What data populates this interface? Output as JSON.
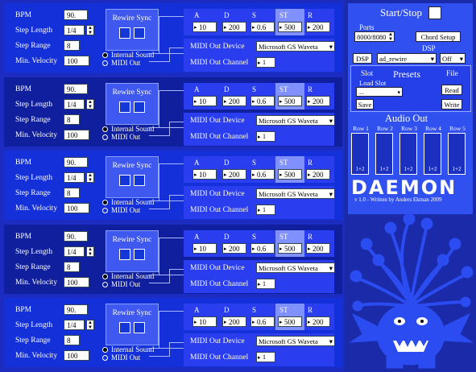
{
  "rows": [
    {
      "bpm": "90.",
      "step_length": "1/4",
      "step_range": "8",
      "min_velocity": "100",
      "rewire_title": "Rewire Sync",
      "radio_internal": "Internal Sound",
      "radio_midi": "MIDI Out",
      "selected": "internal",
      "env": {
        "A": "10",
        "D": "200",
        "S": "0.6",
        "ST": "500",
        "R": "200"
      },
      "midi_device_label": "MIDI Out Device",
      "midi_device": "Microsoft GS Waveta",
      "midi_channel_label": "MIDI Out Channel",
      "midi_channel": "1"
    },
    {
      "bpm": "90.",
      "step_length": "1/4",
      "step_range": "8",
      "min_velocity": "100",
      "rewire_title": "Rewire Sync",
      "radio_internal": "Internal Sound",
      "radio_midi": "MIDI Out",
      "selected": "internal",
      "env": {
        "A": "10",
        "D": "200",
        "S": "0.6",
        "ST": "500",
        "R": "200"
      },
      "midi_device_label": "MIDI Out Device",
      "midi_device": "Microsoft GS Waveta",
      "midi_channel_label": "MIDI Out Channel",
      "midi_channel": "1"
    },
    {
      "bpm": "90.",
      "step_length": "1/4",
      "step_range": "8",
      "min_velocity": "100",
      "rewire_title": "Rewire Sync",
      "radio_internal": "Internal Sound",
      "radio_midi": "MIDI Out",
      "selected": "internal",
      "env": {
        "A": "10",
        "D": "200",
        "S": "0.6",
        "ST": "500",
        "R": "200"
      },
      "midi_device_label": "MIDI Out Device",
      "midi_device": "Microsoft GS Waveta",
      "midi_channel_label": "MIDI Out Channel",
      "midi_channel": "1"
    },
    {
      "bpm": "90.",
      "step_length": "1/4",
      "step_range": "8",
      "min_velocity": "100",
      "rewire_title": "Rewire Sync",
      "radio_internal": "Internal Sound",
      "radio_midi": "MIDI Out",
      "selected": "internal",
      "env": {
        "A": "10",
        "D": "200",
        "S": "0.6",
        "ST": "500",
        "R": "200"
      },
      "midi_device_label": "MIDI Out Device",
      "midi_device": "Microsoft GS Waveta",
      "midi_channel_label": "MIDI Out Channel",
      "midi_channel": "1"
    },
    {
      "bpm": "90.",
      "step_length": "1/4",
      "step_range": "8",
      "min_velocity": "100",
      "rewire_title": "Rewire Sync",
      "radio_internal": "Internal Sound",
      "radio_midi": "MIDI Out",
      "selected": "internal",
      "env": {
        "A": "10",
        "D": "200",
        "S": "0.6",
        "ST": "500",
        "R": "200"
      },
      "midi_device_label": "MIDI Out Device",
      "midi_device": "Microsoft GS Waveta",
      "midi_channel_label": "MIDI Out Channel",
      "midi_channel": "1"
    }
  ],
  "labels": {
    "bpm": "BPM",
    "step_length": "Step Length",
    "step_range": "Step Range",
    "min_velocity": "Min. Velocity"
  },
  "env_labels": [
    "A",
    "D",
    "S",
    "ST",
    "R"
  ],
  "right": {
    "start_stop": "Start/Stop",
    "ports_label": "Ports",
    "ports_value": "8000/8080",
    "chord_setup": "Chord Setup",
    "dsp_label": "DSP",
    "dsp_button": "DSP",
    "dsp_select": "ad_rewire",
    "dsp_off": "Off",
    "slot_label": "Slot",
    "presets_label": "Presets",
    "file_label": "File",
    "load_slot_label": "Load Slot",
    "load_slot_value": "....",
    "read_button": "Read",
    "save_button": "Save",
    "write_button": "Write",
    "audio_out_label": "Audio Out",
    "audio_rows": [
      "Row 1",
      "Row 2",
      "Row 3",
      "Row 4",
      "Row 5"
    ],
    "audio_channels": [
      "1+2",
      "1+2",
      "1+2",
      "1+2",
      "1+2"
    ],
    "logo": "DAEMON",
    "credit": "v 1.0 - Written by Anders Ekman 2009"
  },
  "colors": {
    "background": "#1a2aa8",
    "panel": "#3050f0",
    "row": "#1430d8",
    "row_alt": "#0f1f9e",
    "monster": "#2a4cf0"
  }
}
